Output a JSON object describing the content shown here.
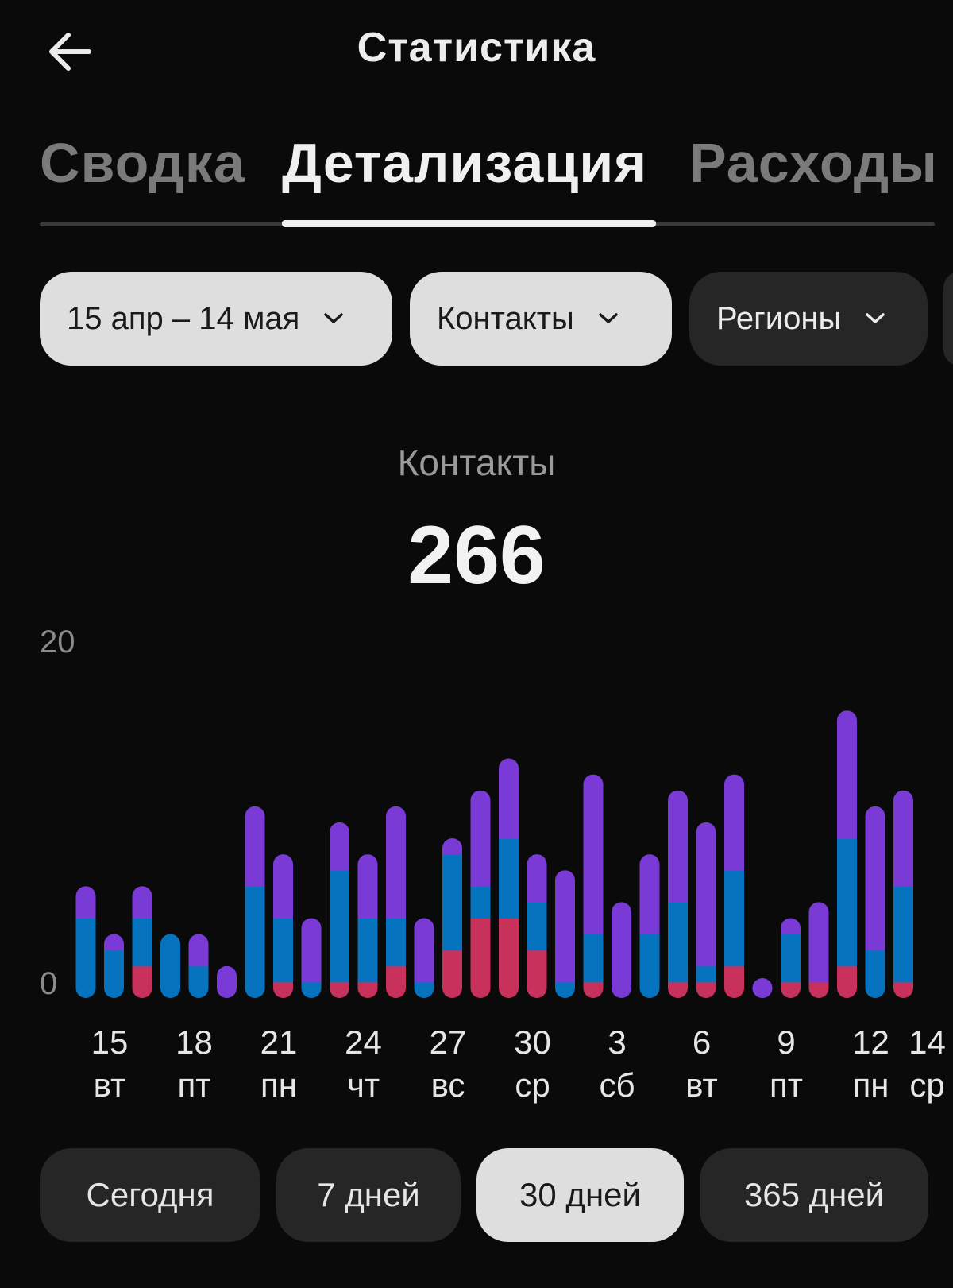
{
  "header": {
    "title": "Статистика",
    "back_icon": "arrow-left-icon"
  },
  "tabs": [
    {
      "label": "Сводка",
      "active": false
    },
    {
      "label": "Детализация",
      "active": true
    },
    {
      "label": "Расходы",
      "active": false
    }
  ],
  "filters": [
    {
      "label": "15 апр – 14 мая",
      "style": "light",
      "icon": "chevron-down-icon"
    },
    {
      "label": "Контакты",
      "style": "light",
      "icon": "chevron-down-icon"
    },
    {
      "label": "Регионы",
      "style": "dark",
      "icon": "chevron-down-icon"
    }
  ],
  "metric": {
    "label": "Контакты",
    "value": "266"
  },
  "colors": {
    "background": "#0a0a0b",
    "red": "#c9315d",
    "blue": "#0673bf",
    "purple": "#7a3ad6"
  },
  "chart_data": {
    "type": "bar",
    "stacked": true,
    "ylim": [
      0,
      20
    ],
    "y_tick_labels": [
      "20",
      "0"
    ],
    "x_tick_labels": [
      {
        "day": "15",
        "weekday": "вт"
      },
      {
        "day": "18",
        "weekday": "пт"
      },
      {
        "day": "21",
        "weekday": "пн"
      },
      {
        "day": "24",
        "weekday": "чт"
      },
      {
        "day": "27",
        "weekday": "вс"
      },
      {
        "day": "30",
        "weekday": "ср"
      },
      {
        "day": "3",
        "weekday": "сб"
      },
      {
        "day": "6",
        "weekday": "вт"
      },
      {
        "day": "9",
        "weekday": "пт"
      },
      {
        "day": "12",
        "weekday": "пн"
      },
      {
        "day": "14",
        "weekday": "ср"
      }
    ],
    "categories": [
      "15",
      "16",
      "17",
      "18",
      "19",
      "20",
      "21",
      "22",
      "23",
      "24",
      "25",
      "26",
      "27",
      "28",
      "29",
      "30",
      "1",
      "2",
      "3",
      "4",
      "5",
      "6",
      "7",
      "8",
      "9",
      "10",
      "11",
      "12",
      "13",
      "14"
    ],
    "series": [
      {
        "color": "#c9315d",
        "values": [
          0,
          0,
          2,
          0,
          0,
          0,
          0,
          1,
          0,
          1,
          1,
          2,
          0,
          3,
          5,
          5,
          3,
          0,
          1,
          0,
          0,
          1,
          1,
          2,
          0,
          1,
          1,
          2,
          0,
          1
        ]
      },
      {
        "color": "#0673bf",
        "values": [
          5,
          3,
          3,
          4,
          2,
          0,
          7,
          4,
          1,
          7,
          4,
          3,
          1,
          6,
          2,
          5,
          3,
          1,
          3,
          0,
          4,
          5,
          1,
          6,
          0,
          3,
          0,
          8,
          3,
          6
        ]
      },
      {
        "color": "#7a3ad6",
        "values": [
          2,
          1,
          2,
          0,
          2,
          2,
          5,
          4,
          4,
          3,
          4,
          7,
          4,
          1,
          6,
          5,
          3,
          7,
          10,
          6,
          5,
          7,
          9,
          6,
          1,
          1,
          5,
          8,
          9,
          6
        ]
      }
    ]
  },
  "periods": [
    {
      "label": "Сегодня",
      "active": false
    },
    {
      "label": "7 дней",
      "active": false
    },
    {
      "label": "30 дней",
      "active": true
    },
    {
      "label": "365 дней",
      "active": false
    }
  ]
}
